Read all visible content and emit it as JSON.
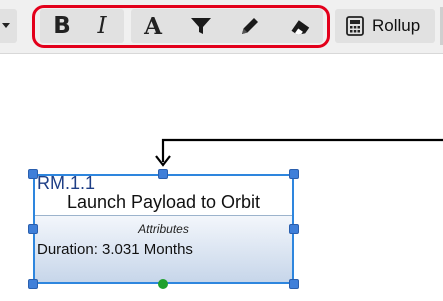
{
  "toolbar": {
    "bold_button": {
      "label": "B",
      "icon": "bold-icon"
    },
    "italic_button": {
      "label": "I",
      "icon": "italic-icon"
    },
    "font_color_button": {
      "label": "A",
      "icon": "font-color-icon"
    },
    "fill_button": {
      "icon": "funnel-fill-icon"
    },
    "line_color_button": {
      "icon": "pencil-icon"
    },
    "clear_format_button": {
      "icon": "eraser-icon"
    },
    "rollup_button": {
      "label": "Rollup",
      "icon": "calculator-icon"
    },
    "highlight_color": "#e3001b"
  },
  "diagram": {
    "node": {
      "id": "RM.1.1",
      "title": "Launch Payload to Orbit",
      "attributes_heading": "Attributes",
      "attributes": [
        {
          "text": "Duration: 3.031 Months"
        }
      ],
      "selected": true,
      "border_color": "#2e86de",
      "handle_color": "#3f7fd9",
      "rotate_handle_color": "#1fa02c"
    }
  }
}
